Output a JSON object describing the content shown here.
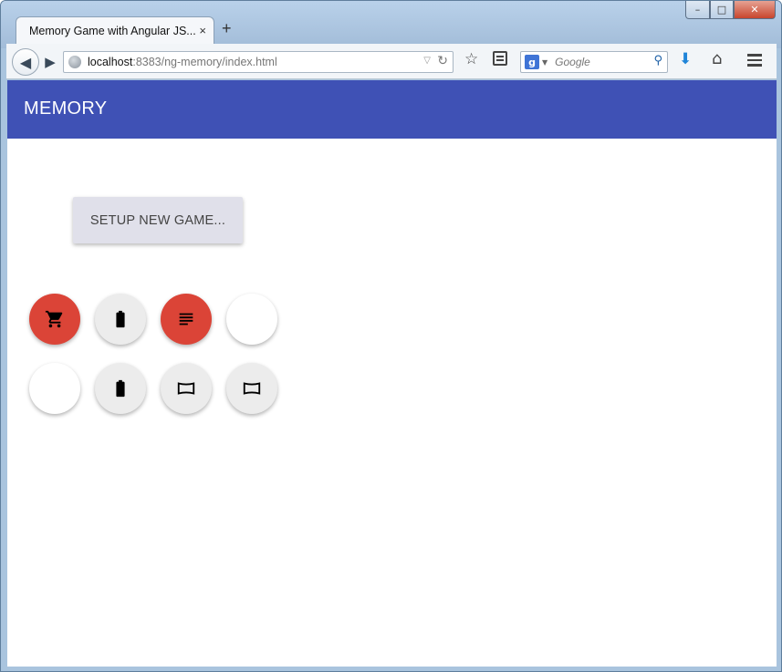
{
  "browser": {
    "tab_title": "Memory Game with Angular JS...",
    "tab_close": "×",
    "new_tab": "+",
    "url_host": "localhost",
    "url_rest": ":8383/ng-memory/index.html",
    "search_placeholder": "Google",
    "window_controls": {
      "minimize": "–",
      "maximize": "□",
      "close": "✕"
    }
  },
  "app": {
    "title": "MEMORY",
    "setup_button": "SETUP NEW GAME..."
  },
  "colors": {
    "toolbar": "#3f51b5",
    "card_revealed": "#db4437",
    "card_flipped": "#ececec",
    "card_hidden": "#ffffff"
  },
  "cards": [
    {
      "row": 1,
      "col": 1,
      "state": "revealed",
      "icon": "shopping-cart-icon"
    },
    {
      "row": 1,
      "col": 2,
      "state": "flipped",
      "icon": "battery-icon"
    },
    {
      "row": 1,
      "col": 3,
      "state": "revealed",
      "icon": "text-lines-icon"
    },
    {
      "row": 1,
      "col": 4,
      "state": "hidden",
      "icon": ""
    },
    {
      "row": 2,
      "col": 1,
      "state": "hidden",
      "icon": ""
    },
    {
      "row": 2,
      "col": 2,
      "state": "flipped",
      "icon": "battery-icon"
    },
    {
      "row": 2,
      "col": 3,
      "state": "flipped",
      "icon": "panorama-icon"
    },
    {
      "row": 2,
      "col": 4,
      "state": "flipped",
      "icon": "panorama-icon"
    }
  ]
}
